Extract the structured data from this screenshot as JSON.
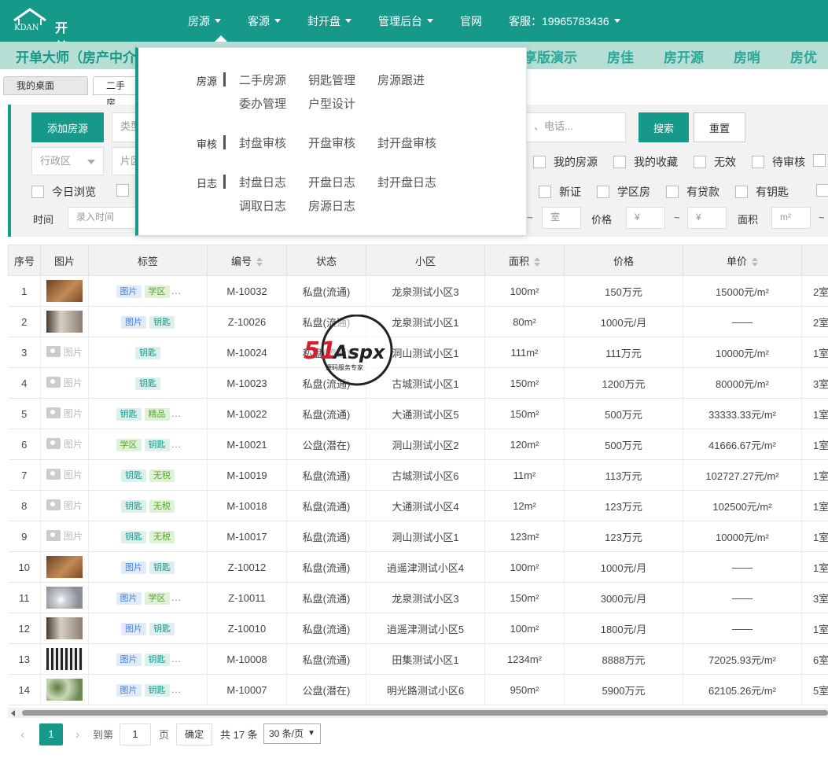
{
  "app": {
    "logo_text": "开单大师",
    "logo_mark": "KDAN"
  },
  "nav": {
    "items": [
      {
        "label": "房源",
        "has_caret": true
      },
      {
        "label": "客源",
        "has_caret": true
      },
      {
        "label": "封开盘",
        "has_caret": true
      },
      {
        "label": "管理后台",
        "has_caret": true
      },
      {
        "label": "官网",
        "has_caret": false
      },
      {
        "label": "客服：19965783436",
        "has_caret": true
      }
    ]
  },
  "band": {
    "title": "开单大师（房产中介",
    "items": [
      "享版演示",
      "房佳",
      "房开源",
      "房哨",
      "房优"
    ]
  },
  "tabs": {
    "items": [
      "我的桌面",
      "二手房"
    ]
  },
  "filters": {
    "add_button": "添加房源",
    "type_placeholder": "类型",
    "search_placeholder": "、电话...",
    "search_button": "搜索",
    "reset_button": "重置",
    "district_select": "行政区",
    "area_placeholder": "片区",
    "row2_checks": [
      "我的房源",
      "我的收藏",
      "无效",
      "待审核"
    ],
    "row3_checks_left": [
      "今日浏览"
    ],
    "row3_checks_right": [
      "新证",
      "学区房",
      "有贷款",
      "有钥匙"
    ],
    "time_label": "时间",
    "time_placeholder": "录入时间",
    "room_placeholder": "室",
    "price_label": "价格",
    "price_unit": "¥",
    "area_label": "面积",
    "area_unit": "m²",
    "tilde": "~"
  },
  "dropdown": {
    "groups": [
      {
        "category": "房源",
        "links": [
          "二手房源",
          "钥匙管理",
          "房源跟进",
          "委办管理",
          "户型设计"
        ]
      },
      {
        "category": "审核",
        "links": [
          "封盘审核",
          "开盘审核",
          "封开盘审核"
        ]
      },
      {
        "category": "日志",
        "links": [
          "封盘日志",
          "开盘日志",
          "封开盘日志",
          "调取日志",
          "房源日志"
        ]
      }
    ]
  },
  "table": {
    "headers": [
      "序号",
      "图片",
      "标签",
      "编号",
      "状态",
      "小区",
      "面积",
      "价格",
      "单价",
      ""
    ],
    "no_image_text": "图片",
    "rows": [
      {
        "no": "1",
        "img": "photo-wood",
        "tags": [
          [
            "图片",
            "blue"
          ],
          [
            "学区",
            "green"
          ]
        ],
        "more": true,
        "code": "M-10032",
        "status": "私盘(流通)",
        "estate": "龙泉测试小区3",
        "area": "100m²",
        "price": "150万元",
        "unit": "15000元/m²",
        "room": "2室"
      },
      {
        "no": "2",
        "img": "photo-room",
        "tags": [
          [
            "图片",
            "blue"
          ],
          [
            "钥匙",
            "teal"
          ]
        ],
        "more": false,
        "code": "Z-10026",
        "status": "私盘(流通)",
        "estate": "龙泉测试小区1",
        "area": "80m²",
        "price": "1000元/月",
        "unit": "——",
        "room": "2室"
      },
      {
        "no": "3",
        "img": "none",
        "tags": [
          [
            "钥匙",
            "teal"
          ]
        ],
        "more": false,
        "code": "M-10024",
        "status": "私盘(流通)",
        "estate": "洞山测试小区1",
        "area": "111m²",
        "price": "111万元",
        "unit": "10000元/m²",
        "room": "1室"
      },
      {
        "no": "4",
        "img": "none",
        "tags": [
          [
            "钥匙",
            "teal"
          ]
        ],
        "more": false,
        "code": "M-10023",
        "status": "私盘(流通)",
        "estate": "古城测试小区1",
        "area": "150m²",
        "price": "1200万元",
        "unit": "80000元/m²",
        "room": "3室"
      },
      {
        "no": "5",
        "img": "none",
        "tags": [
          [
            "钥匙",
            "teal"
          ],
          [
            "精品",
            "green"
          ]
        ],
        "more": true,
        "code": "M-10022",
        "status": "私盘(流通)",
        "estate": "大通测试小区5",
        "area": "150m²",
        "price": "500万元",
        "unit": "33333.33元/m²",
        "room": "1室"
      },
      {
        "no": "6",
        "img": "none",
        "tags": [
          [
            "学区",
            "green"
          ],
          [
            "钥匙",
            "teal"
          ]
        ],
        "more": true,
        "code": "M-10021",
        "status": "公盘(潜在)",
        "estate": "洞山测试小区2",
        "area": "120m²",
        "price": "500万元",
        "unit": "41666.67元/m²",
        "room": "1室"
      },
      {
        "no": "7",
        "img": "none",
        "tags": [
          [
            "钥匙",
            "teal"
          ],
          [
            "无税",
            "green"
          ]
        ],
        "more": false,
        "code": "M-10019",
        "status": "私盘(流通)",
        "estate": "古城测试小区6",
        "area": "11m²",
        "price": "113万元",
        "unit": "102727.27元/m²",
        "room": "1室"
      },
      {
        "no": "8",
        "img": "none",
        "tags": [
          [
            "钥匙",
            "teal"
          ],
          [
            "无税",
            "green"
          ]
        ],
        "more": false,
        "code": "M-10018",
        "status": "私盘(流通)",
        "estate": "大通测试小区4",
        "area": "12m²",
        "price": "123万元",
        "unit": "102500元/m²",
        "room": "1室"
      },
      {
        "no": "9",
        "img": "none",
        "tags": [
          [
            "钥匙",
            "teal"
          ],
          [
            "无税",
            "green"
          ]
        ],
        "more": false,
        "code": "M-10017",
        "status": "私盘(流通)",
        "estate": "洞山测试小区1",
        "area": "123m²",
        "price": "123万元",
        "unit": "10000元/m²",
        "room": "1室"
      },
      {
        "no": "10",
        "img": "photo-wood",
        "tags": [
          [
            "图片",
            "blue"
          ],
          [
            "钥匙",
            "teal"
          ]
        ],
        "more": false,
        "code": "Z-10012",
        "status": "私盘(流通)",
        "estate": "逍遥津测试小区4",
        "area": "100m²",
        "price": "1000元/月",
        "unit": "——",
        "room": "1室"
      },
      {
        "no": "11",
        "img": "photo-ceiling",
        "tags": [
          [
            "图片",
            "blue"
          ],
          [
            "学区",
            "green"
          ]
        ],
        "more": true,
        "code": "Z-10011",
        "status": "私盘(流通)",
        "estate": "龙泉测试小区3",
        "area": "150m²",
        "price": "3000元/月",
        "unit": "——",
        "room": "3室"
      },
      {
        "no": "12",
        "img": "photo-room",
        "tags": [
          [
            "图片",
            "blue"
          ],
          [
            "钥匙",
            "teal"
          ]
        ],
        "more": false,
        "code": "Z-10010",
        "status": "私盘(流通)",
        "estate": "逍遥津测试小区5",
        "area": "100m²",
        "price": "1800元/月",
        "unit": "——",
        "room": "1室"
      },
      {
        "no": "13",
        "img": "photo-qr",
        "tags": [
          [
            "图片",
            "blue"
          ],
          [
            "钥匙",
            "teal"
          ]
        ],
        "more": true,
        "code": "M-10008",
        "status": "私盘(流通)",
        "estate": "田集测试小区1",
        "area": "1234m²",
        "price": "8888万元",
        "unit": "72025.93元/m²",
        "room": "6室"
      },
      {
        "no": "14",
        "img": "photo-tree",
        "tags": [
          [
            "图片",
            "blue"
          ],
          [
            "钥匙",
            "teal"
          ]
        ],
        "more": true,
        "code": "M-10007",
        "status": "公盘(潜在)",
        "estate": "明光路测试小区6",
        "area": "950m²",
        "price": "5900万元",
        "unit": "62105.26元/m²",
        "room": "5室"
      }
    ]
  },
  "pager": {
    "prev": "‹",
    "current": "1",
    "next": "›",
    "goto_label": "到第",
    "goto_value": "1",
    "page_label": "页",
    "confirm": "确定",
    "total": "共 17 条",
    "page_size": "30 条/页"
  },
  "watermark": {
    "brand": "51Aspx",
    "slogan": "源码服务专家"
  },
  "colors": {
    "primary": "#17998a",
    "band": "#b6ded4",
    "code_sale": "#17998a",
    "code_rent": "#2f8fd0"
  }
}
